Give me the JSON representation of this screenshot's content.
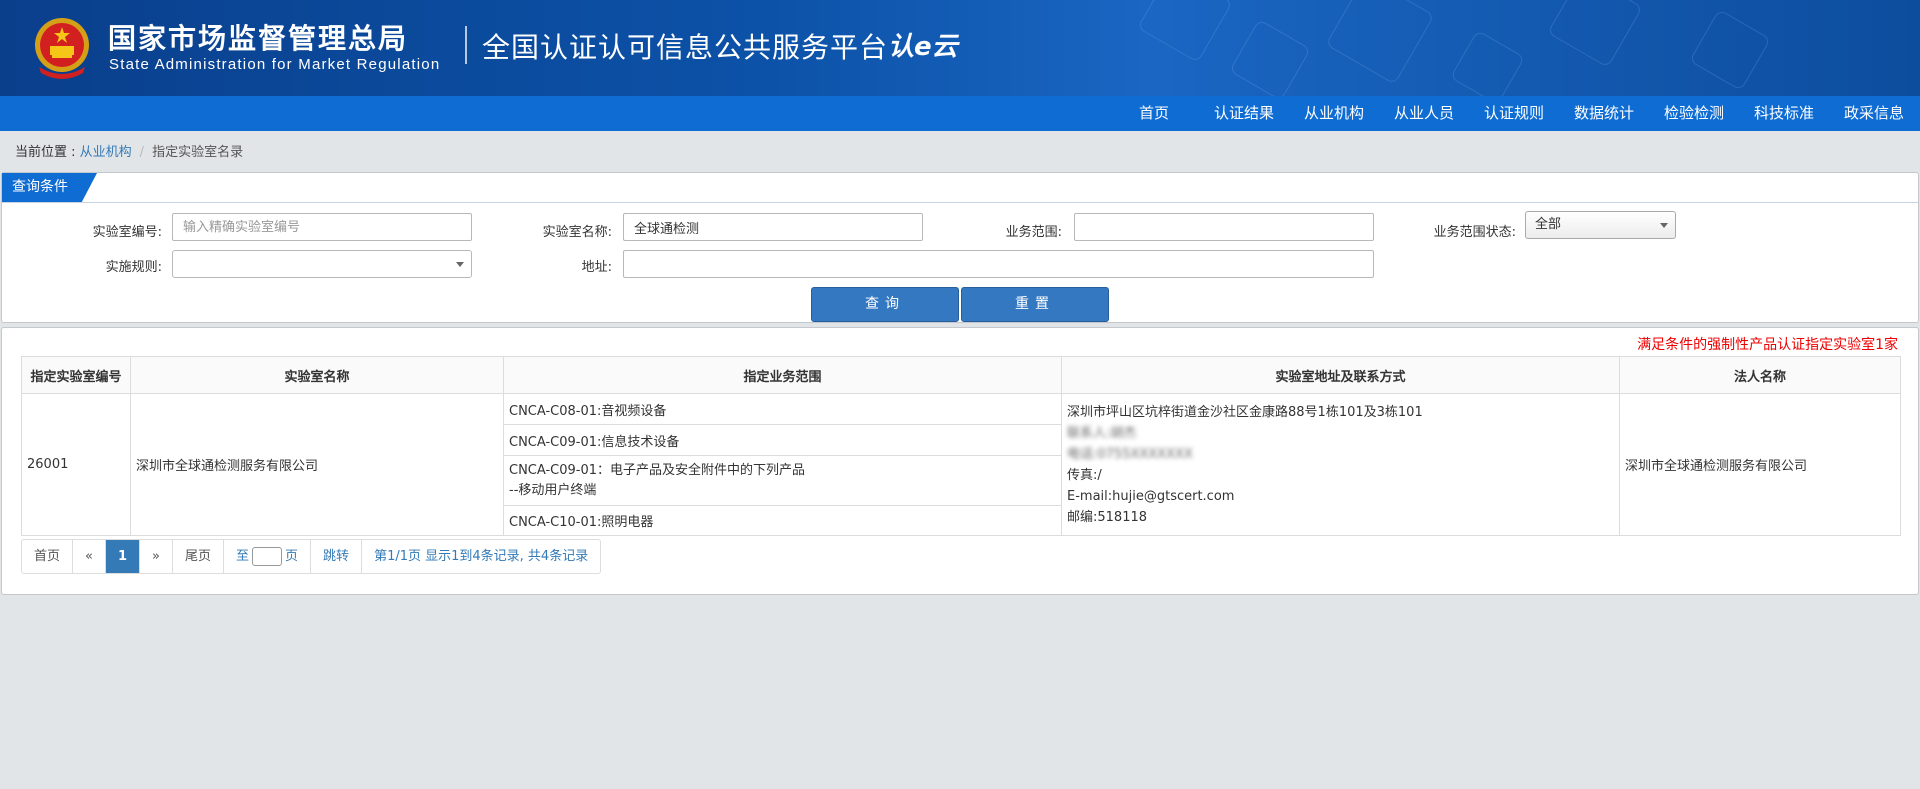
{
  "header": {
    "title_cn": "国家市场监督管理总局",
    "title_en": "State Administration  for  Market Regulation",
    "platform": "全国认证认可信息公共服务平台",
    "logo_text": "认e云"
  },
  "nav": {
    "items": [
      "首页",
      "认证结果",
      "从业机构",
      "从业人员",
      "认证规则",
      "数据统计",
      "检验检测",
      "科技标准",
      "政采信息"
    ]
  },
  "breadcrumb": {
    "prefix": "当前位置 : ",
    "link": "从业机构",
    "separator": "/",
    "current": "指定实验室名录"
  },
  "query": {
    "tab_label": "查询条件",
    "lab_no_label": "实验室编号:",
    "lab_no_placeholder": "输入精确实验室编号",
    "lab_name_label": "实验室名称:",
    "lab_name_value": "全球通检测",
    "scope_label": "业务范围:",
    "scope_value": "",
    "scope_status_label": "业务范围状态:",
    "scope_status_value": "全部",
    "rule_label": "实施规则:",
    "rule_value": "",
    "address_label": "地址:",
    "address_value": "",
    "search_button": "查询",
    "reset_button": "重置"
  },
  "result": {
    "count_text": "满足条件的强制性产品认证指定实验室1家",
    "columns": [
      "指定实验室编号",
      "实验室名称",
      "指定业务范围",
      "实验室地址及联系方式",
      "法人名称"
    ],
    "rows": [
      {
        "lab_no": "26001",
        "lab_name": "深圳市全球通检测服务有限公司",
        "scopes": [
          "CNCA-C08-01:音视频设备",
          "CNCA-C09-01:信息技术设备",
          "CNCA-C09-01：电子产品及安全附件中的下列产品",
          "--移动用户终端",
          "CNCA-C10-01:照明电器"
        ],
        "contact": {
          "address": "深圳市坪山区坑梓街道金沙社区金康路88号1栋101及3栋101",
          "person": "联系人:胡杰",
          "phone": "电话:0755XXXXXXX",
          "fax": "传真:/",
          "email": "E-mail:hujie@gtscert.com",
          "postcode": "邮编:518118"
        },
        "legal_name": "深圳市全球通检测服务有限公司"
      }
    ]
  },
  "pager": {
    "first": "首页",
    "prev": "«",
    "current": "1",
    "next": "»",
    "last": "尾页",
    "goto_prefix": "至",
    "goto_suffix": "页",
    "jump": "跳转",
    "info": "第1/1页  显示1到4条记录, 共4条记录"
  }
}
